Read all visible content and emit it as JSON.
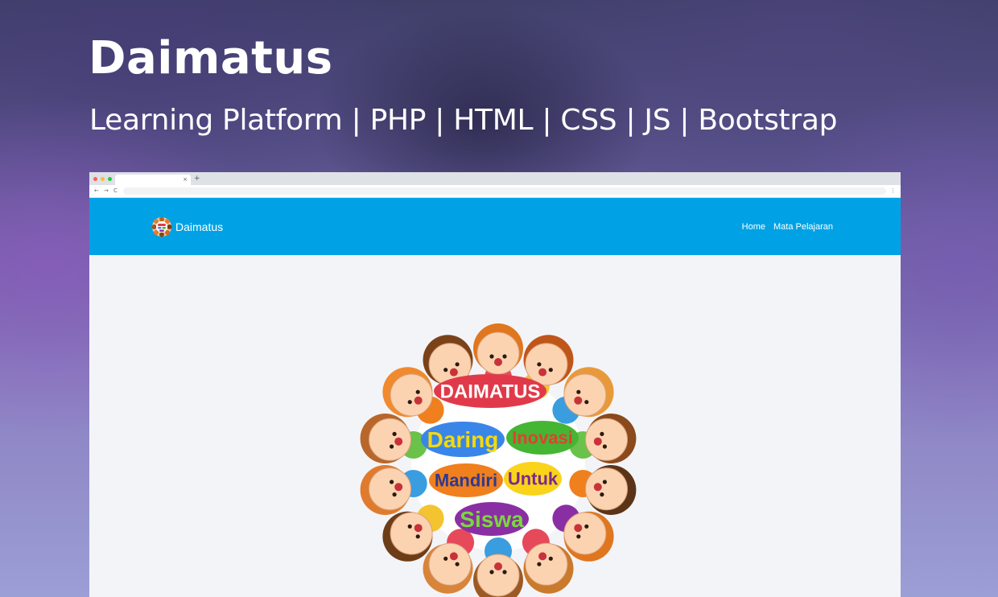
{
  "header": {
    "title": "Daimatus",
    "subtitle": "Learning Platform | PHP | HTML | CSS | JS | Bootstrap"
  },
  "browser": {
    "tab_close": "×",
    "new_tab": "+",
    "back": "←",
    "forward": "→",
    "reload": "C",
    "menu": "⋮",
    "dot_colors": [
      "#ff5f57",
      "#febc2e",
      "#28c840"
    ]
  },
  "site": {
    "brand_name": "Daimatus",
    "nav_items": [
      "Home",
      "Mata Pelajaran"
    ],
    "navbar_color": "#00a2e5",
    "content_bg": "#f3f4f8"
  },
  "illustration": {
    "bubbles": [
      {
        "text": "DAIMATUS",
        "fill": "#e03a4a",
        "text_color": "#ffffff"
      },
      {
        "text": "Daring",
        "fill": "#3a86e8",
        "text_color": "#f5d90a"
      },
      {
        "text": "Inovasi",
        "fill": "#45b534",
        "text_color": "#e0412f"
      },
      {
        "text": "Mandiri",
        "fill": "#f07f1e",
        "text_color": "#2d3a8f"
      },
      {
        "text": "Untuk",
        "fill": "#f9d41a",
        "text_color": "#7b2890"
      },
      {
        "text": "Siswa",
        "fill": "#8a2fa3",
        "text_color": "#7ad83c"
      }
    ]
  }
}
